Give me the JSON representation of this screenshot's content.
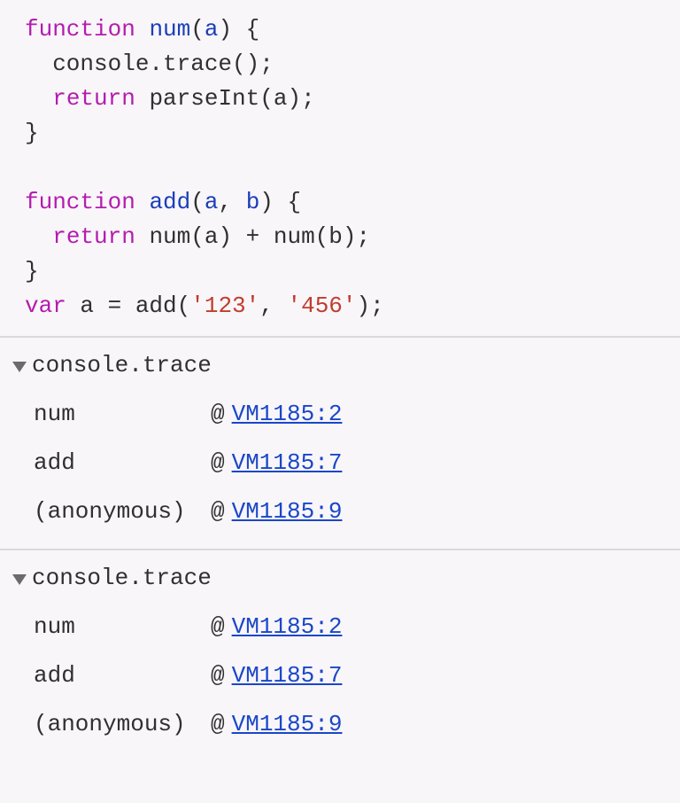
{
  "code": {
    "lines": [
      {
        "tokens": [
          {
            "t": "function",
            "c": "kw"
          },
          {
            "t": " ",
            "c": ""
          },
          {
            "t": "num",
            "c": "fn-name"
          },
          {
            "t": "(",
            "c": "punct"
          },
          {
            "t": "a",
            "c": "param"
          },
          {
            "t": ") {",
            "c": "punct"
          }
        ]
      },
      {
        "tokens": [
          {
            "t": "  console.trace();",
            "c": "call"
          }
        ]
      },
      {
        "tokens": [
          {
            "t": "  ",
            "c": ""
          },
          {
            "t": "return",
            "c": "kw"
          },
          {
            "t": " parseInt(a);",
            "c": "call"
          }
        ]
      },
      {
        "tokens": [
          {
            "t": "}",
            "c": "punct"
          }
        ]
      },
      {
        "tokens": [
          {
            "t": "",
            "c": ""
          }
        ]
      },
      {
        "tokens": [
          {
            "t": "function",
            "c": "kw"
          },
          {
            "t": " ",
            "c": ""
          },
          {
            "t": "add",
            "c": "fn-name"
          },
          {
            "t": "(",
            "c": "punct"
          },
          {
            "t": "a",
            "c": "param"
          },
          {
            "t": ", ",
            "c": "punct"
          },
          {
            "t": "b",
            "c": "param"
          },
          {
            "t": ") {",
            "c": "punct"
          }
        ]
      },
      {
        "tokens": [
          {
            "t": "  ",
            "c": ""
          },
          {
            "t": "return",
            "c": "kw"
          },
          {
            "t": " num(a) + num(b);",
            "c": "call"
          }
        ]
      },
      {
        "tokens": [
          {
            "t": "}",
            "c": "punct"
          }
        ]
      },
      {
        "tokens": [
          {
            "t": "var",
            "c": "kw"
          },
          {
            "t": " a = add(",
            "c": "call"
          },
          {
            "t": "'123'",
            "c": "str"
          },
          {
            "t": ", ",
            "c": "punct"
          },
          {
            "t": "'456'",
            "c": "str"
          },
          {
            "t": ");",
            "c": "punct"
          }
        ]
      }
    ]
  },
  "traces": [
    {
      "title": "console.trace",
      "frames": [
        {
          "fn": "num",
          "at": "@",
          "link": "VM1185:2"
        },
        {
          "fn": "add",
          "at": "@",
          "link": "VM1185:7"
        },
        {
          "fn": "(anonymous)",
          "at": "@",
          "link": "VM1185:9"
        }
      ]
    },
    {
      "title": "console.trace",
      "frames": [
        {
          "fn": "num",
          "at": "@",
          "link": "VM1185:2"
        },
        {
          "fn": "add",
          "at": "@",
          "link": "VM1185:7"
        },
        {
          "fn": "(anonymous)",
          "at": "@",
          "link": "VM1185:9"
        }
      ]
    }
  ]
}
